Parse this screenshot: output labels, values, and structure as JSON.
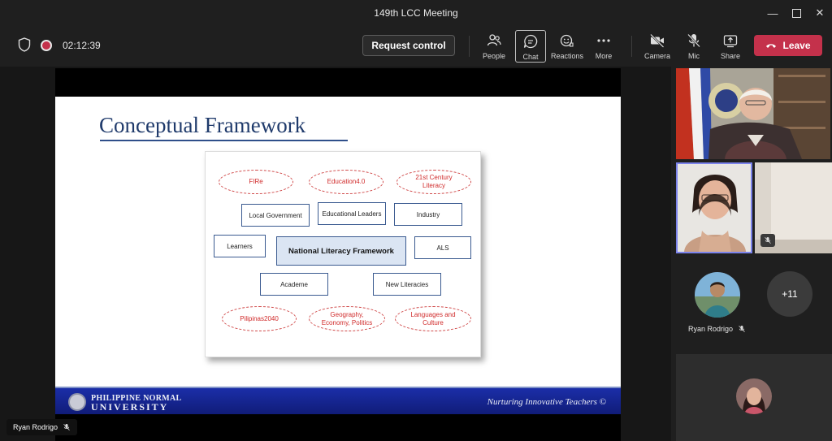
{
  "window": {
    "title": "149th LCC Meeting"
  },
  "toolbar": {
    "timer": "02:12:39",
    "request_control": "Request control",
    "buttons": {
      "people": "People",
      "chat": "Chat",
      "reactions": "Reactions",
      "more": "More",
      "camera": "Camera",
      "mic": "Mic",
      "share": "Share"
    },
    "leave": "Leave"
  },
  "slide": {
    "title": "Conceptual Framework",
    "ovals_top": [
      "FIRe",
      "Education4.0",
      "21st Century Literacy"
    ],
    "rect_row1": [
      "Local Government",
      "Educational Leaders",
      "Industry"
    ],
    "learners": "Learners",
    "core": "National Literacy Framework",
    "als": "ALS",
    "rect_row3": [
      "Academe",
      "New Literacies"
    ],
    "ovals_bottom": [
      "Pilipinas2040",
      "Geography, Economy, Politics",
      "Languages and Culture"
    ],
    "banner": {
      "university_line1": "PHILIPPINE NORMAL",
      "university_line2": "UNIVERSITY",
      "motto": "Nurturing Innovative Teachers ©"
    }
  },
  "presenter": {
    "name": "Ryan Rodrigo"
  },
  "roster": {
    "participant_name": "Ryan Rodrigo",
    "more_count": "+11"
  },
  "colors": {
    "leave": "#c4314b",
    "active_border": "#7b83eb",
    "slide_title": "#1f3a6b"
  }
}
